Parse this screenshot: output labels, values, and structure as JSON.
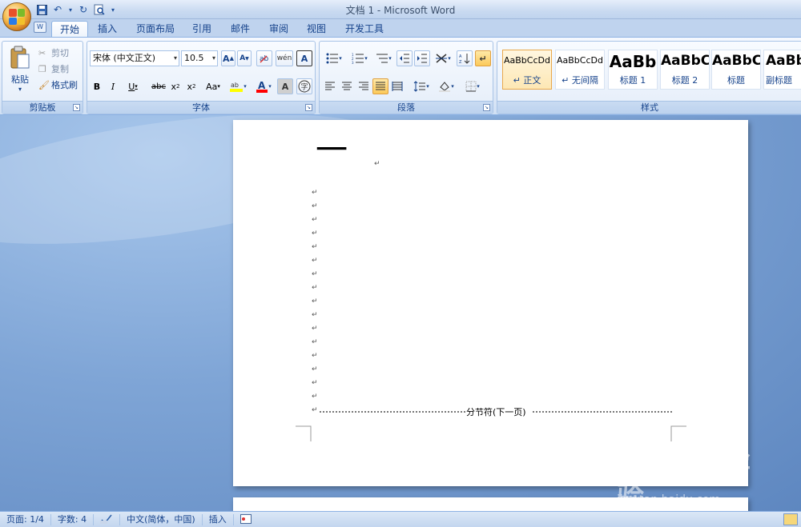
{
  "window": {
    "title": "文档 1 - Microsoft Word"
  },
  "qat": {
    "icons": [
      "save-icon",
      "undo-icon",
      "redo-icon",
      "print-preview-icon",
      "customize-icon"
    ]
  },
  "tabs": [
    {
      "label": "开始",
      "active": true
    },
    {
      "label": "插入"
    },
    {
      "label": "页面布局"
    },
    {
      "label": "引用"
    },
    {
      "label": "邮件"
    },
    {
      "label": "审阅"
    },
    {
      "label": "视图"
    },
    {
      "label": "开发工具"
    }
  ],
  "clipboard": {
    "label": "剪贴板",
    "paste": "粘贴",
    "cut": "剪切",
    "copy": "复制",
    "format_painter": "格式刷"
  },
  "font": {
    "label": "字体",
    "font_name": "宋体 (中文正文)",
    "font_size": "10.5",
    "aa_label": "Aa"
  },
  "paragraph": {
    "label": "段落"
  },
  "styles": {
    "label": "样式",
    "items": [
      {
        "sample": "AaBbCcDd",
        "name": "↵ 正文",
        "selected": true
      },
      {
        "sample": "AaBbCcDd",
        "name": "↵ 无间隔"
      },
      {
        "sample": "AaBb",
        "name": "标题 1"
      },
      {
        "sample": "AaBbC",
        "name": "标题 2"
      },
      {
        "sample": "AaBbC",
        "name": "标题"
      },
      {
        "sample": "AaBb",
        "name": "副标题"
      }
    ]
  },
  "document": {
    "heading": "一",
    "paragraph_mark": "↵",
    "section_break": "分节符(下一页)"
  },
  "watermark": {
    "text": "Bai du 经验",
    "sub": "jingyan.baidu.com"
  },
  "status": {
    "page": "页面: 1/4",
    "words": "字数: 4",
    "language": "中文(简体，中国)",
    "mode": "插入"
  },
  "colors": {
    "accent": "#15428b",
    "selected_style": "#fde7b4",
    "font_color_bar": "#ff0000",
    "highlight_bar": "#ffff00"
  }
}
